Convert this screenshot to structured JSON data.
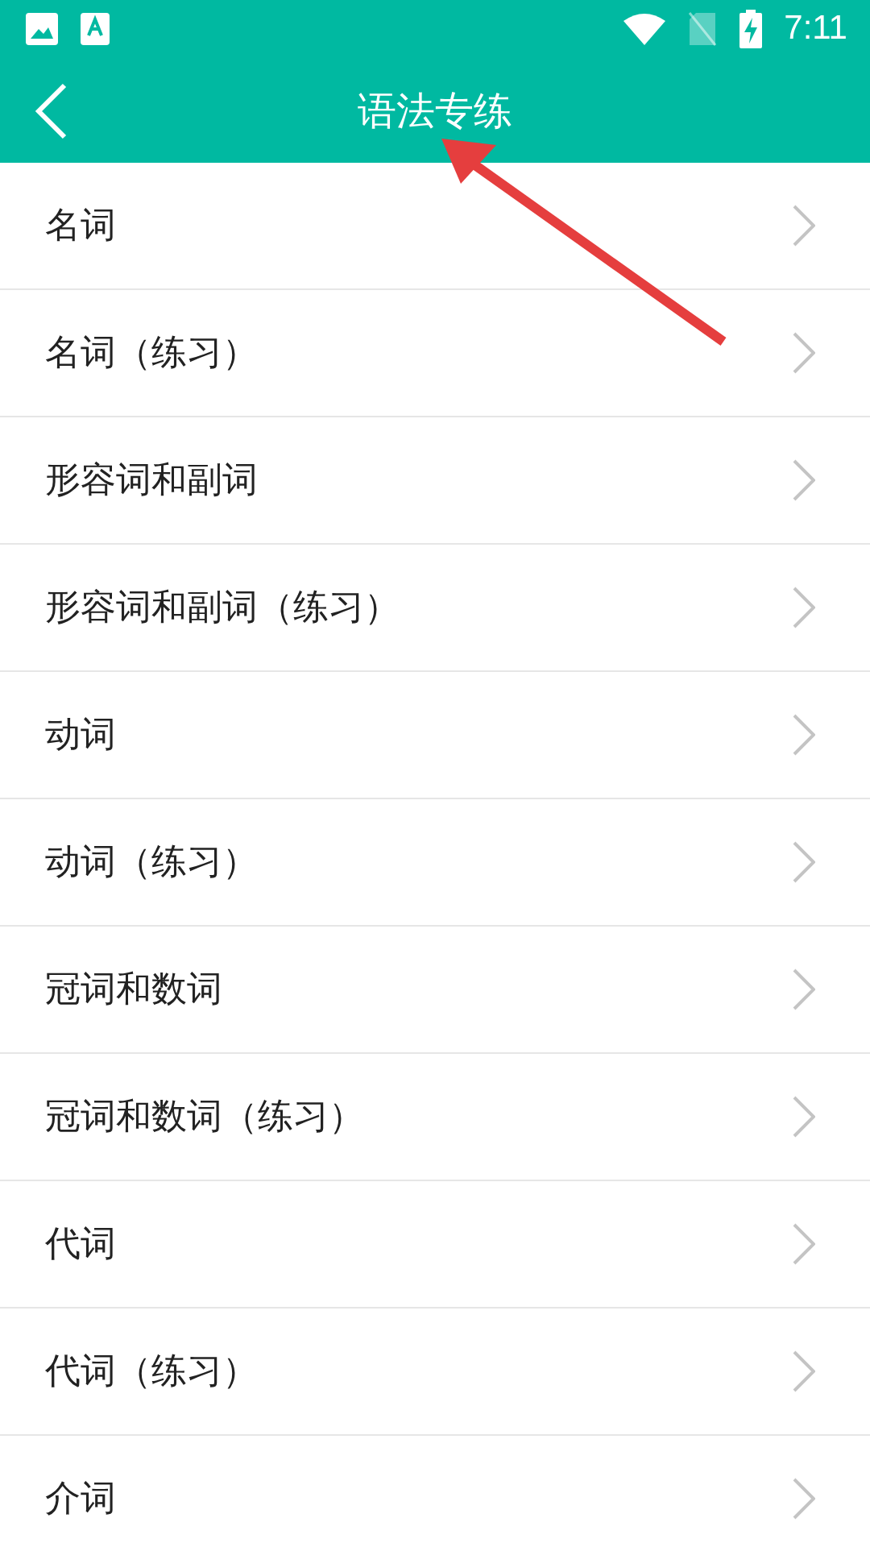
{
  "status_bar": {
    "time": "7:11"
  },
  "app_bar": {
    "title": "语法专练"
  },
  "items": [
    {
      "label": "名词"
    },
    {
      "label": "名词（练习）"
    },
    {
      "label": "形容词和副词"
    },
    {
      "label": "形容词和副词（练习）"
    },
    {
      "label": "动词"
    },
    {
      "label": "动词（练习）"
    },
    {
      "label": "冠词和数词"
    },
    {
      "label": "冠词和数词（练习）"
    },
    {
      "label": "代词"
    },
    {
      "label": "代词（练习）"
    },
    {
      "label": "介词"
    }
  ]
}
